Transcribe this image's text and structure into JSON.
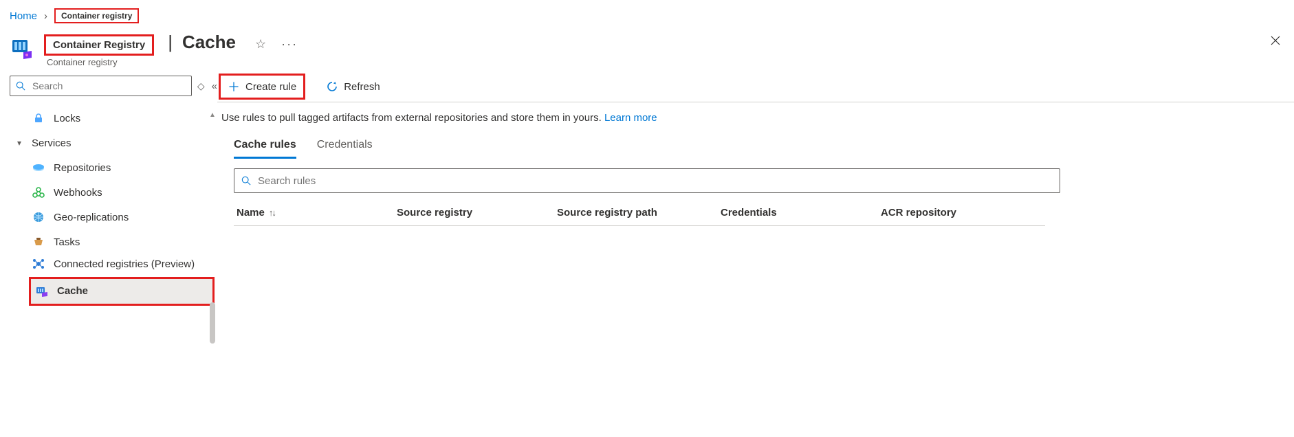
{
  "breadcrumb": {
    "home": "Home",
    "resource": "Container registry"
  },
  "header": {
    "resource_name": "Container Registry",
    "page": "Cache",
    "subtype": "Container registry"
  },
  "sidebar": {
    "search_placeholder": "Search",
    "items": {
      "locks": "Locks",
      "services_group": "Services",
      "repositories": "Repositories",
      "webhooks": "Webhooks",
      "georeplications": "Geo-replications",
      "tasks": "Tasks",
      "connected": "Connected registries (Preview)",
      "cache": "Cache"
    }
  },
  "commands": {
    "create": "Create rule",
    "refresh": "Refresh"
  },
  "description": {
    "text": "Use rules to pull tagged artifacts from external repositories and store them in yours. ",
    "link": "Learn more"
  },
  "tabs": {
    "rules": "Cache rules",
    "creds": "Credentials"
  },
  "rules_search_placeholder": "Search rules",
  "columns": {
    "name": "Name",
    "source_registry": "Source registry",
    "source_registry_path": "Source registry path",
    "credentials": "Credentials",
    "acr_repository": "ACR repository"
  }
}
